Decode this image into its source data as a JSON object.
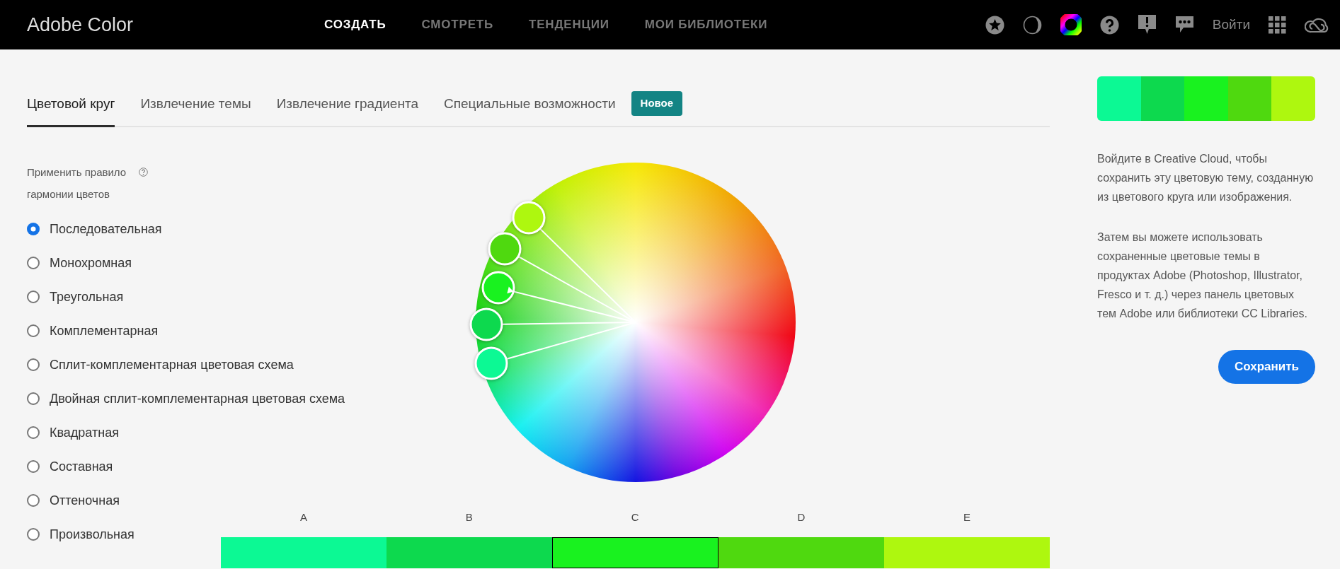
{
  "header": {
    "logo": "Adobe Color",
    "nav": [
      {
        "label": "СОЗДАТЬ",
        "selected": true
      },
      {
        "label": "СМОТРЕТЬ",
        "selected": false
      },
      {
        "label": "ТЕНДЕНЦИИ",
        "selected": false
      },
      {
        "label": "МОИ БИБЛИОТЕКИ",
        "selected": false
      }
    ],
    "signin": "Войти"
  },
  "tabs": [
    {
      "label": "Цветовой круг",
      "selected": true
    },
    {
      "label": "Извлечение темы",
      "selected": false
    },
    {
      "label": "Извлечение градиента",
      "selected": false
    },
    {
      "label": "Специальные возможности",
      "selected": false
    }
  ],
  "new_badge": "Новое",
  "harmony": {
    "label": "Применить правило гармонии цветов",
    "options": [
      {
        "label": "Последовательная",
        "selected": true
      },
      {
        "label": "Монохромная",
        "selected": false
      },
      {
        "label": "Треугольная",
        "selected": false
      },
      {
        "label": "Комплементарная",
        "selected": false
      },
      {
        "label": "Сплит-комплементарная цветовая схема",
        "selected": false
      },
      {
        "label": "Двойная сплит-комплементарная цветовая схема",
        "selected": false
      },
      {
        "label": "Квадратная",
        "selected": false
      },
      {
        "label": "Составная",
        "selected": false
      },
      {
        "label": "Оттеночная",
        "selected": false
      },
      {
        "label": "Произвольная",
        "selected": false
      }
    ]
  },
  "swatches": [
    {
      "label": "A",
      "color": "#0cf994",
      "selected": false
    },
    {
      "label": "B",
      "color": "#0dd94e",
      "selected": false
    },
    {
      "label": "C",
      "color": "#19f21f",
      "selected": true
    },
    {
      "label": "D",
      "color": "#4fd90f",
      "selected": false
    },
    {
      "label": "E",
      "color": "#aef70f",
      "selected": false
    }
  ],
  "side_panel": {
    "theme_colors": [
      {
        "color": "#0cf994"
      },
      {
        "color": "#0dd94e"
      },
      {
        "color": "#19f21f"
      },
      {
        "color": "#4fd90f"
      },
      {
        "color": "#aef70f"
      }
    ],
    "paragraphs": [
      "Войдите в Creative Cloud, чтобы сохранить эту цветовую тему, созданную из цветового круга или изображения.",
      "Затем вы можете использовать сохраненные цветовые темы в продуктах Adobe (Photoshop, Illustrator, Fresco и т. д.) через панель цветовых тем Adobe или библиотеки CC Libraries."
    ],
    "save_button": "Сохранить"
  }
}
